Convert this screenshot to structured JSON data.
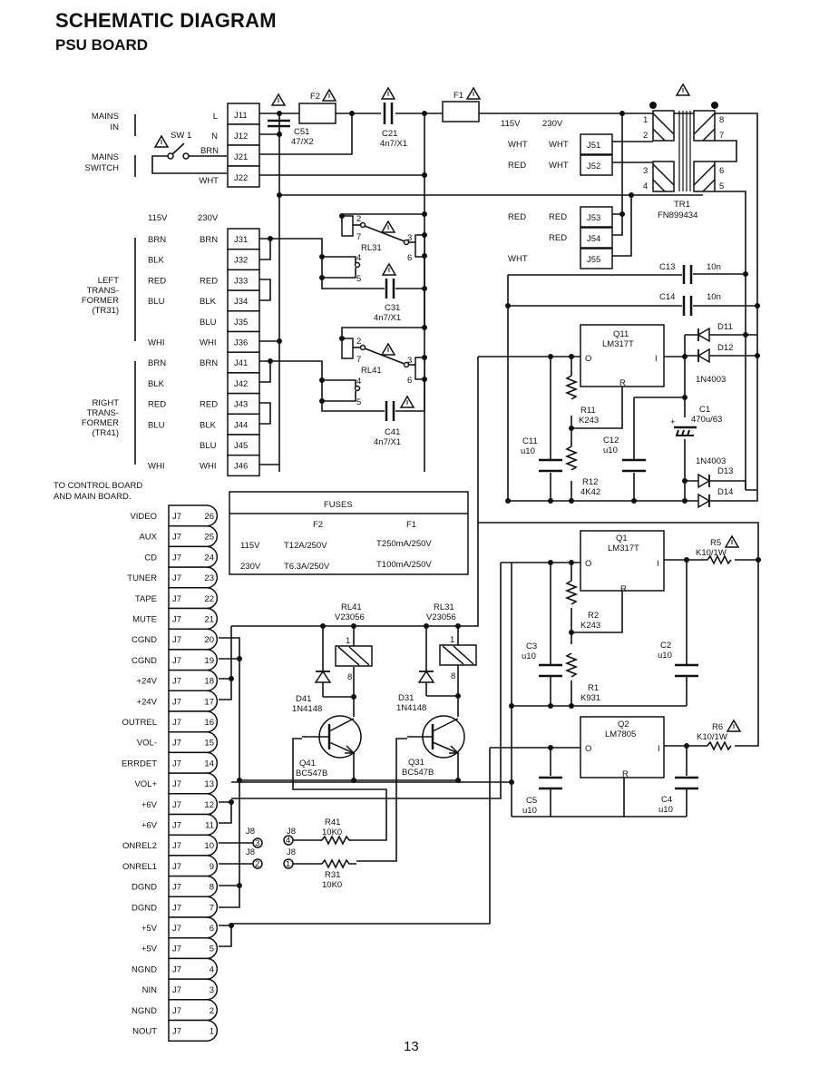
{
  "header": {
    "title": "SCHEMATIC DIAGRAM",
    "subtitle": "PSU BOARD"
  },
  "page_number": "13",
  "mains": {
    "mains_in_label": [
      "MAINS",
      "IN"
    ],
    "mains_switch_label": [
      "MAINS",
      "SWITCH"
    ],
    "switch": "SW 1",
    "wires": [
      "L",
      "N",
      "BRN",
      "WHT"
    ],
    "connectors": [
      "J11",
      "J12",
      "J21",
      "J22"
    ]
  },
  "components": {
    "C51": {
      "name": "C51",
      "value": "47/X2"
    },
    "F2": {
      "name": "F2"
    },
    "C21": {
      "name": "C21",
      "value": "4n7/X1"
    },
    "F1": {
      "name": "F1"
    },
    "TR1": {
      "name": "TR1",
      "value": "FN899434",
      "pins": [
        "1",
        "2",
        "3",
        "4",
        "5",
        "6",
        "7",
        "8"
      ]
    },
    "C13": {
      "name": "C13",
      "value": "10n"
    },
    "C14": {
      "name": "C14",
      "value": "10n"
    },
    "RL31_sw": {
      "name": "RL31",
      "pins": [
        "2",
        "7",
        "3",
        "6",
        "4",
        "5"
      ]
    },
    "RL41_sw": {
      "name": "RL41",
      "pins": [
        "2",
        "7",
        "3",
        "6",
        "4",
        "5"
      ]
    },
    "C31": {
      "name": "C31",
      "value": "4n7/X1"
    },
    "C41": {
      "name": "C41",
      "value": "4n7/X1"
    },
    "Q11": {
      "name": "Q11",
      "value": "LM317T",
      "pins": [
        "O",
        "I",
        "R"
      ]
    },
    "D11": {
      "name": "D11"
    },
    "D12": {
      "name": "D12"
    },
    "D13": {
      "name": "D13"
    },
    "D14": {
      "name": "D14"
    },
    "diode_type": "1N4003",
    "C1": {
      "name": "C1",
      "value": "470u/63"
    },
    "R11": {
      "name": "R11",
      "value": "K243"
    },
    "R12": {
      "name": "R12",
      "value": "4K42"
    },
    "C11": {
      "name": "C11",
      "value": "u10"
    },
    "C12": {
      "name": "C12",
      "value": "u10"
    },
    "Q1": {
      "name": "Q1",
      "value": "LM317T",
      "pins": [
        "O",
        "I",
        "R"
      ]
    },
    "R5": {
      "name": "R5",
      "value": "K10/1W"
    },
    "R2": {
      "name": "R2",
      "value": "K243"
    },
    "R1": {
      "name": "R1",
      "value": "K931"
    },
    "C3": {
      "name": "C3",
      "value": "u10"
    },
    "C2": {
      "name": "C2",
      "value": "u10"
    },
    "Q2": {
      "name": "Q2",
      "value": "LM7805",
      "pins": [
        "O",
        "I",
        "R"
      ]
    },
    "R6": {
      "name": "R6",
      "value": "K10/1W"
    },
    "C5": {
      "name": "C5",
      "value": "u10"
    },
    "C4": {
      "name": "C4",
      "value": "u10"
    },
    "RL41": {
      "name": "RL41",
      "value": "V23056",
      "pins": [
        "1",
        "8"
      ]
    },
    "RL31": {
      "name": "RL31",
      "value": "V23056",
      "pins": [
        "1",
        "8"
      ]
    },
    "D41": {
      "name": "D41",
      "value": "1N4148"
    },
    "D31": {
      "name": "D31",
      "value": "1N4148"
    },
    "Q41": {
      "name": "Q41",
      "value": "BC547B"
    },
    "Q31": {
      "name": "Q31",
      "value": "BC547B"
    },
    "R41": {
      "name": "R41",
      "value": "10K0"
    },
    "R31": {
      "name": "R31",
      "value": "10K0"
    }
  },
  "tr1_taps": {
    "headers": [
      "115V",
      "230V"
    ],
    "rows": [
      {
        "c115": "WHT",
        "c230": "WHT",
        "conn": "J51"
      },
      {
        "c115": "RED",
        "c230": "WHT",
        "conn": "J52"
      },
      {
        "c115": "RED",
        "c230": "RED",
        "conn": "J53"
      },
      {
        "c115": "",
        "c230": "RED",
        "conn": "J54"
      },
      {
        "c115": "WHT",
        "c230": "",
        "conn": "J55"
      }
    ]
  },
  "transformers": {
    "headers": [
      "115V",
      "230V"
    ],
    "left_label": [
      "LEFT",
      "TRANS-",
      "FORMER",
      "(TR31)"
    ],
    "right_label": [
      "RIGHT",
      "TRANS-",
      "FORMER",
      "(TR41)"
    ],
    "rows": [
      {
        "c115": "BRN",
        "c230": "BRN",
        "conn": "J31"
      },
      {
        "c115": "BLK",
        "c230": "",
        "conn": "J32"
      },
      {
        "c115": "RED",
        "c230": "RED",
        "conn": "J33"
      },
      {
        "c115": "BLU",
        "c230": "BLK",
        "conn": "J34"
      },
      {
        "c115": "",
        "c230": "BLU",
        "conn": "J35"
      },
      {
        "c115": "WHI",
        "c230": "WHI",
        "conn": "J36"
      },
      {
        "c115": "BRN",
        "c230": "BRN",
        "conn": "J41"
      },
      {
        "c115": "BLK",
        "c230": "",
        "conn": "J42"
      },
      {
        "c115": "RED",
        "c230": "RED",
        "conn": "J43"
      },
      {
        "c115": "BLU",
        "c230": "BLK",
        "conn": "J44"
      },
      {
        "c115": "",
        "c230": "BLU",
        "conn": "J45"
      },
      {
        "c115": "WHI",
        "c230": "WHI",
        "conn": "J46"
      }
    ]
  },
  "fuses_table": {
    "title": "FUSES",
    "columns": [
      "",
      "F2",
      "F1"
    ],
    "rows": [
      [
        "115V",
        "T12A/250V",
        "T250mA/250V"
      ],
      [
        "230V",
        "T6.3A/250V",
        "T100mA/250V"
      ]
    ]
  },
  "j7": {
    "label": [
      "TO CONTROL BOARD",
      "AND MAIN BOARD."
    ],
    "connector": "J7",
    "pins": [
      {
        "pin": "26",
        "signal": "VIDEO"
      },
      {
        "pin": "25",
        "signal": "AUX"
      },
      {
        "pin": "24",
        "signal": "CD"
      },
      {
        "pin": "23",
        "signal": "TUNER"
      },
      {
        "pin": "22",
        "signal": "TAPE"
      },
      {
        "pin": "21",
        "signal": "MUTE"
      },
      {
        "pin": "20",
        "signal": "CGND"
      },
      {
        "pin": "19",
        "signal": "CGND"
      },
      {
        "pin": "18",
        "signal": "+24V"
      },
      {
        "pin": "17",
        "signal": "+24V"
      },
      {
        "pin": "16",
        "signal": "OUTREL"
      },
      {
        "pin": "15",
        "signal": "VOL-"
      },
      {
        "pin": "14",
        "signal": "ERRDET"
      },
      {
        "pin": "13",
        "signal": "VOL+"
      },
      {
        "pin": "12",
        "signal": "+6V"
      },
      {
        "pin": "11",
        "signal": "+6V"
      },
      {
        "pin": "10",
        "signal": "ONREL2"
      },
      {
        "pin": "9",
        "signal": "ONREL1"
      },
      {
        "pin": "8",
        "signal": "DGND"
      },
      {
        "pin": "7",
        "signal": "DGND"
      },
      {
        "pin": "6",
        "signal": "+5V"
      },
      {
        "pin": "5",
        "signal": "+5V"
      },
      {
        "pin": "4",
        "signal": "NGND"
      },
      {
        "pin": "3",
        "signal": "NIN"
      },
      {
        "pin": "2",
        "signal": "NGND"
      },
      {
        "pin": "1",
        "signal": "NOUT"
      }
    ]
  },
  "j8": {
    "connector": "J8",
    "pins": [
      "3",
      "2",
      "4",
      "1"
    ]
  }
}
